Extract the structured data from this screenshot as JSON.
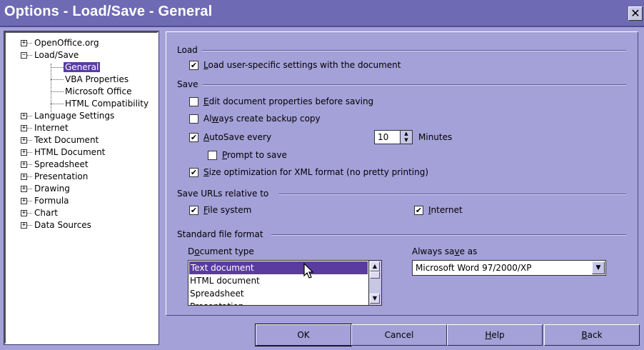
{
  "window": {
    "title": "Options - Load/Save - General",
    "close_symbol": "✕"
  },
  "tree": {
    "items": [
      {
        "label": "OpenOffice.org",
        "toggle": "+"
      },
      {
        "label": "Load/Save",
        "toggle": "−"
      },
      {
        "label": "General",
        "selected": true
      },
      {
        "label": "VBA Properties"
      },
      {
        "label": "Microsoft Office"
      },
      {
        "label": "HTML Compatibility"
      },
      {
        "label": "Language Settings",
        "toggle": "+"
      },
      {
        "label": "Internet",
        "toggle": "+"
      },
      {
        "label": "Text Document",
        "toggle": "+"
      },
      {
        "label": "HTML Document",
        "toggle": "+"
      },
      {
        "label": "Spreadsheet",
        "toggle": "+"
      },
      {
        "label": "Presentation",
        "toggle": "+"
      },
      {
        "label": "Drawing",
        "toggle": "+"
      },
      {
        "label": "Formula",
        "toggle": "+"
      },
      {
        "label": "Chart",
        "toggle": "+"
      },
      {
        "label": "Data Sources",
        "toggle": "+"
      }
    ]
  },
  "load": {
    "section": "Load",
    "user_settings": {
      "pre": "",
      "u": "L",
      "post": "oad user-specific settings with the document",
      "checked": true
    }
  },
  "save": {
    "section": "Save",
    "edit_props": {
      "pre": "",
      "u": "E",
      "post": "dit document properties before saving",
      "checked": false
    },
    "backup": {
      "pre": "Al",
      "u": "w",
      "post": "ays create backup copy",
      "checked": false
    },
    "autosave": {
      "pre": "",
      "u": "A",
      "post": "utoSave every",
      "checked": true
    },
    "autosave_minutes": "10",
    "minutes_label": "Minutes",
    "prompt": {
      "pre": "",
      "u": "P",
      "post": "rompt to save",
      "checked": false
    },
    "size_opt": {
      "pre": "",
      "u": "S",
      "post": "ize optimization for XML format (no pretty printing)",
      "checked": true
    }
  },
  "urls": {
    "section": "Save URLs relative to",
    "file_system": {
      "pre": "",
      "u": "F",
      "post": "ile system",
      "checked": true
    },
    "internet": {
      "pre": "",
      "u": "I",
      "post": "nternet",
      "checked": true
    }
  },
  "format": {
    "section": "Standard file format",
    "doc_type_label": {
      "pre": "D",
      "u": "o",
      "post": "cument type"
    },
    "doc_types": [
      "Text document",
      "HTML document",
      "Spreadsheet",
      "Presentation"
    ],
    "always_save_label": {
      "pre": "Always sa",
      "u": "v",
      "post": "e as"
    },
    "always_save_value": "Microsoft Word 97/2000/XP"
  },
  "buttons": {
    "ok": "OK",
    "cancel": "Cancel",
    "help": {
      "pre": "",
      "u": "H",
      "post": "elp"
    },
    "back": {
      "pre": "",
      "u": "B",
      "post": "ack"
    }
  },
  "check_symbol": "✔"
}
